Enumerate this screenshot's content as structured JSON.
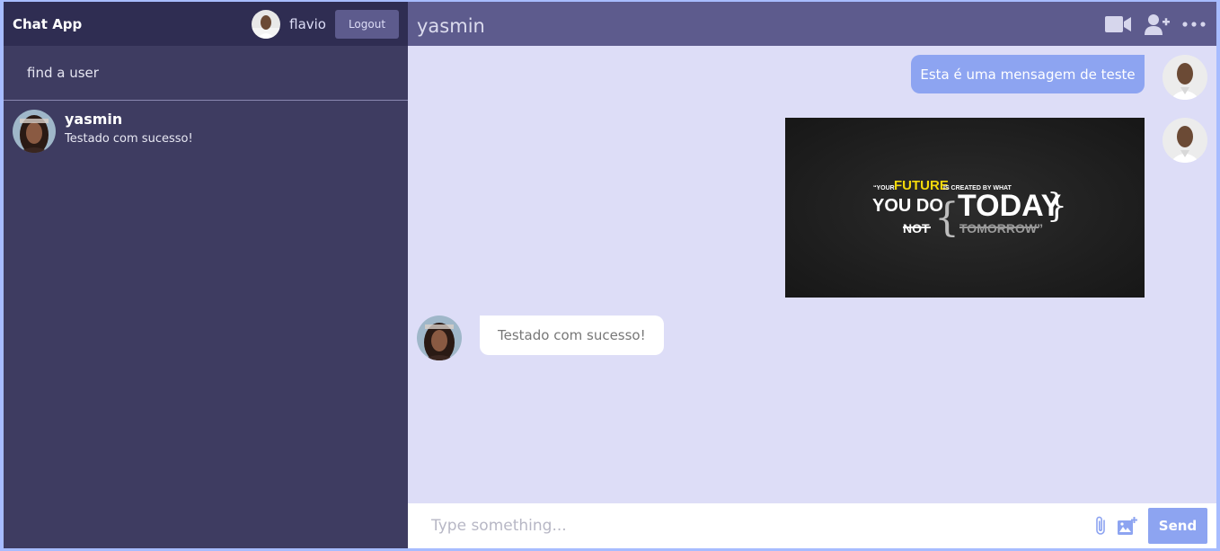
{
  "navbar": {
    "logo": "Chat App",
    "user_name": "flavio",
    "logout_label": "Logout"
  },
  "search": {
    "placeholder": "find a user"
  },
  "chats": [
    {
      "name": "yasmin",
      "last_message": "Testado com sucesso!"
    }
  ],
  "chat": {
    "title": "yasmin",
    "icons": [
      "video-camera-icon",
      "add-user-icon",
      "more-options-icon"
    ],
    "messages": [
      {
        "owner": true,
        "type": "text",
        "text": "Esta é uma mensagem de teste"
      },
      {
        "owner": true,
        "type": "image",
        "image_text": {
          "line1_prefix": "“YOUR",
          "line1_highlight": "FUTURE",
          "line1_suffix": "IS CREATED BY WHAT",
          "line2": "YOU DO",
          "line3": "NOT",
          "today": "TODAY",
          "tomorrow": "TOMORROW”"
        }
      },
      {
        "owner": false,
        "type": "text",
        "text": "Testado com sucesso!"
      }
    ]
  },
  "input": {
    "placeholder": "Type something...",
    "send_label": "Send",
    "icons": [
      "attach-icon",
      "add-image-icon"
    ]
  },
  "colors": {
    "background": "#a7bcff",
    "sidebar": "#3e3c61",
    "navbar": "#2f2d52",
    "chat_header": "#5d5b8d",
    "chat_bg": "#ddddf7",
    "accent": "#8da4f1"
  }
}
